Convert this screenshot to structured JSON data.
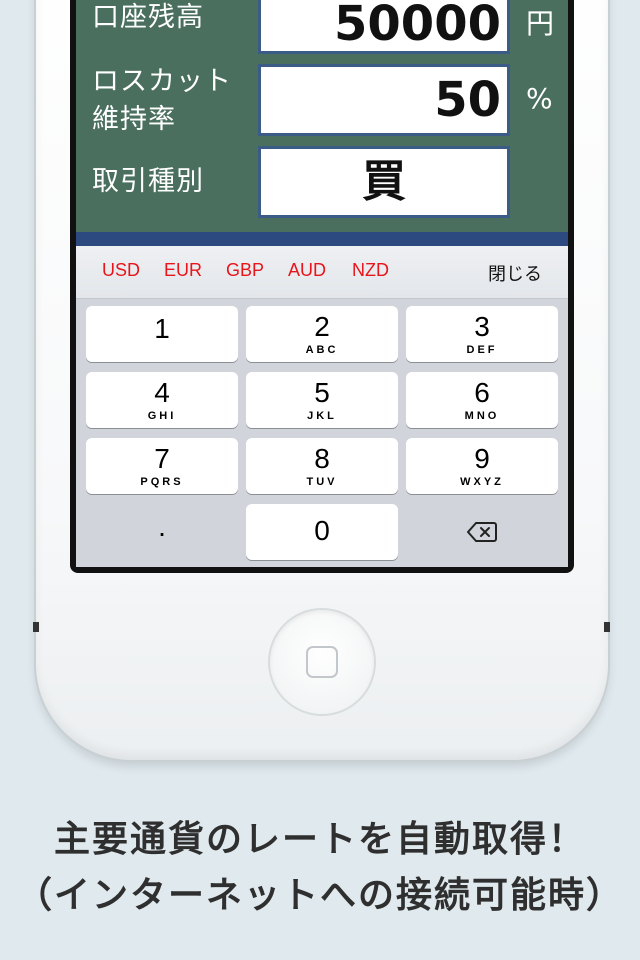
{
  "form": {
    "rows": [
      {
        "label": "口座残高",
        "value": "50000",
        "unit": "円"
      },
      {
        "label_line1": "ロスカット",
        "label_line2": "維持率",
        "value": "50",
        "unit": "%"
      },
      {
        "label": "取引種別",
        "value": "買"
      }
    ]
  },
  "accessory": {
    "currencies": [
      "USD",
      "EUR",
      "GBP",
      "AUD",
      "NZD"
    ],
    "close_label": "閉じる",
    "currency_color": "#e8151b"
  },
  "keypad": {
    "keys": [
      {
        "num": "1",
        "sub": ""
      },
      {
        "num": "2",
        "sub": "ABC"
      },
      {
        "num": "3",
        "sub": "DEF"
      },
      {
        "num": "4",
        "sub": "GHI"
      },
      {
        "num": "5",
        "sub": "JKL"
      },
      {
        "num": "6",
        "sub": "MNO"
      },
      {
        "num": "7",
        "sub": "PQRS"
      },
      {
        "num": "8",
        "sub": "TUV"
      },
      {
        "num": "9",
        "sub": "WXYZ"
      }
    ],
    "dot": ".",
    "zero": "0",
    "delete_icon": "backspace-icon"
  },
  "caption": {
    "line1": "主要通貨のレートを自動取得！",
    "line2": "（インターネットへの接続可能時）"
  }
}
